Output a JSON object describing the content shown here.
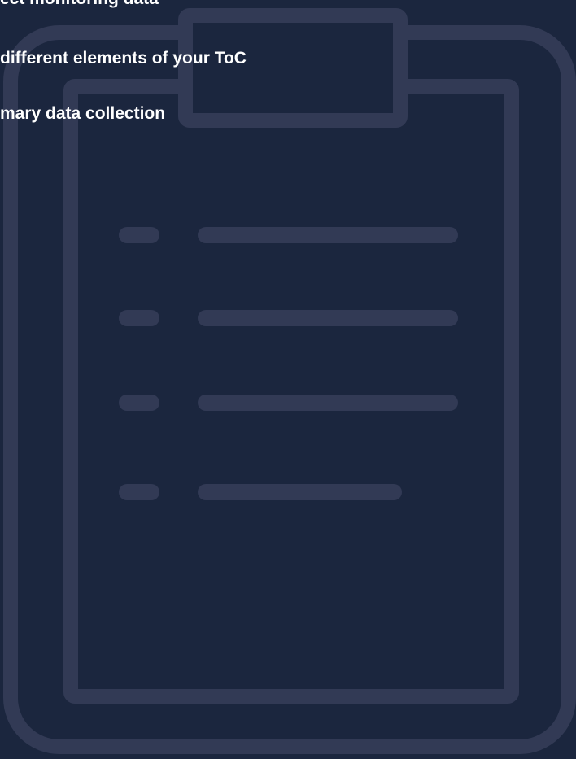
{
  "lines": [
    "ect monitoring data",
    "different elements of your ToC",
    "mary data collection"
  ],
  "illustration": {
    "icon": "clipboard-checklist-icon",
    "checklist_items": 4,
    "colors": {
      "background": "#1b263e",
      "outline": "#323a55",
      "text": "#ffffff"
    }
  }
}
